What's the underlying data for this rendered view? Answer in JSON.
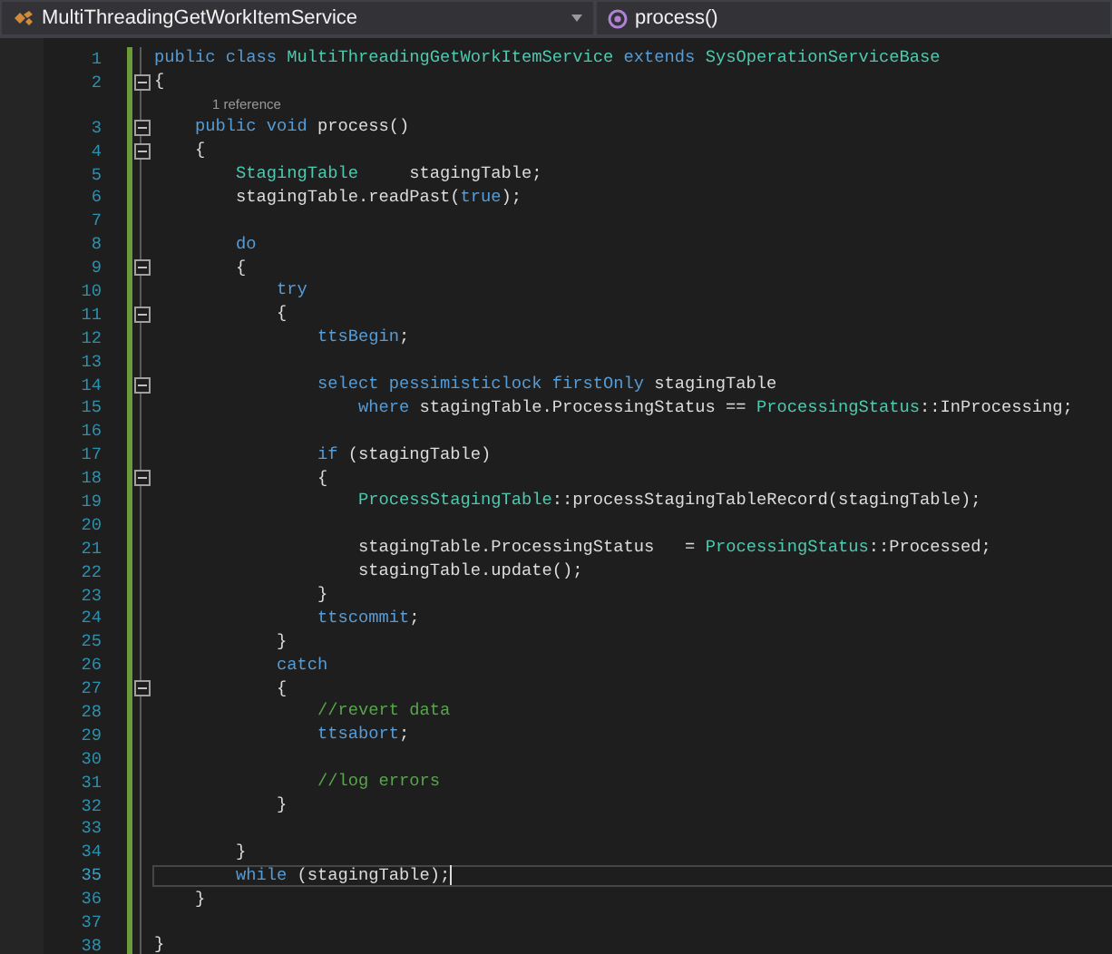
{
  "navigation_bar": {
    "type_dropdown": "MultiThreadingGetWorkItemService",
    "member_dropdown": "process()"
  },
  "lines": [
    {
      "number": "1",
      "fold": false,
      "current": false,
      "tokens": [
        {
          "kind": "keyword",
          "text": "public class "
        },
        {
          "kind": "type",
          "text": "MultiThreadingGetWorkItemService"
        },
        {
          "kind": "keyword",
          "text": " extends "
        },
        {
          "kind": "type",
          "text": "SysOperationServiceBase"
        }
      ]
    },
    {
      "number": "2",
      "fold": true,
      "current": false,
      "tokens": [
        {
          "kind": "plain",
          "text": "{"
        }
      ]
    },
    {
      "number": "3",
      "fold": true,
      "current": false,
      "codelens": "1 reference",
      "tokens": [
        {
          "kind": "keyword",
          "text": "    public void "
        },
        {
          "kind": "plain",
          "text": "process()"
        }
      ]
    },
    {
      "number": "4",
      "fold": true,
      "current": false,
      "tokens": [
        {
          "kind": "plain",
          "text": "    {"
        }
      ]
    },
    {
      "number": "5",
      "fold": false,
      "current": false,
      "tokens": [
        {
          "kind": "type",
          "text": "        StagingTable"
        },
        {
          "kind": "plain",
          "text": "     stagingTable;"
        }
      ]
    },
    {
      "number": "6",
      "fold": false,
      "current": false,
      "tokens": [
        {
          "kind": "plain",
          "text": "        stagingTable.readPast("
        },
        {
          "kind": "keyword",
          "text": "true"
        },
        {
          "kind": "plain",
          "text": ");"
        }
      ]
    },
    {
      "number": "7",
      "fold": false,
      "current": false
    },
    {
      "number": "8",
      "fold": false,
      "current": false,
      "tokens": [
        {
          "kind": "keyword",
          "text": "        do"
        }
      ]
    },
    {
      "number": "9",
      "fold": true,
      "current": false,
      "tokens": [
        {
          "kind": "plain",
          "text": "        {"
        }
      ]
    },
    {
      "number": "10",
      "fold": false,
      "current": false,
      "tokens": [
        {
          "kind": "keyword",
          "text": "            try"
        }
      ]
    },
    {
      "number": "11",
      "fold": true,
      "current": false,
      "tokens": [
        {
          "kind": "plain",
          "text": "            {"
        }
      ]
    },
    {
      "number": "12",
      "fold": false,
      "current": false,
      "tokens": [
        {
          "kind": "keyword",
          "text": "                ttsBegin"
        },
        {
          "kind": "plain",
          "text": ";"
        }
      ]
    },
    {
      "number": "13",
      "fold": false,
      "current": false
    },
    {
      "number": "14",
      "fold": true,
      "current": false,
      "tokens": [
        {
          "kind": "keyword",
          "text": "                select pessimisticlock firstOnly "
        },
        {
          "kind": "plain",
          "text": "stagingTable"
        }
      ]
    },
    {
      "number": "15",
      "fold": false,
      "current": false,
      "tokens": [
        {
          "kind": "keyword",
          "text": "                    where "
        },
        {
          "kind": "plain",
          "text": "stagingTable.ProcessingStatus == "
        },
        {
          "kind": "type",
          "text": "ProcessingStatus"
        },
        {
          "kind": "plain",
          "text": "::InProcessing;"
        }
      ]
    },
    {
      "number": "16",
      "fold": false,
      "current": false
    },
    {
      "number": "17",
      "fold": false,
      "current": false,
      "tokens": [
        {
          "kind": "keyword",
          "text": "                if "
        },
        {
          "kind": "plain",
          "text": "(stagingTable)"
        }
      ]
    },
    {
      "number": "18",
      "fold": true,
      "current": false,
      "tokens": [
        {
          "kind": "plain",
          "text": "                {"
        }
      ]
    },
    {
      "number": "19",
      "fold": false,
      "current": false,
      "tokens": [
        {
          "kind": "type",
          "text": "                    ProcessStagingTable"
        },
        {
          "kind": "plain",
          "text": "::processStagingTableRecord(stagingTable);"
        }
      ]
    },
    {
      "number": "20",
      "fold": false,
      "current": false
    },
    {
      "number": "21",
      "fold": false,
      "current": false,
      "tokens": [
        {
          "kind": "plain",
          "text": "                    stagingTable.ProcessingStatus   = "
        },
        {
          "kind": "type",
          "text": "ProcessingStatus"
        },
        {
          "kind": "plain",
          "text": "::Processed;"
        }
      ]
    },
    {
      "number": "22",
      "fold": false,
      "current": false,
      "tokens": [
        {
          "kind": "plain",
          "text": "                    stagingTable.update();"
        }
      ]
    },
    {
      "number": "23",
      "fold": false,
      "current": false,
      "tokens": [
        {
          "kind": "plain",
          "text": "                }"
        }
      ]
    },
    {
      "number": "24",
      "fold": false,
      "current": false,
      "tokens": [
        {
          "kind": "keyword",
          "text": "                ttscommit"
        },
        {
          "kind": "plain",
          "text": ";"
        }
      ]
    },
    {
      "number": "25",
      "fold": false,
      "current": false,
      "tokens": [
        {
          "kind": "plain",
          "text": "            }"
        }
      ]
    },
    {
      "number": "26",
      "fold": false,
      "current": false,
      "tokens": [
        {
          "kind": "keyword",
          "text": "            catch"
        }
      ]
    },
    {
      "number": "27",
      "fold": true,
      "current": false,
      "tokens": [
        {
          "kind": "plain",
          "text": "            {"
        }
      ]
    },
    {
      "number": "28",
      "fold": false,
      "current": false,
      "tokens": [
        {
          "kind": "comment",
          "text": "                //revert data"
        }
      ]
    },
    {
      "number": "29",
      "fold": false,
      "current": false,
      "tokens": [
        {
          "kind": "keyword",
          "text": "                ttsabort"
        },
        {
          "kind": "plain",
          "text": ";"
        }
      ]
    },
    {
      "number": "30",
      "fold": false,
      "current": false
    },
    {
      "number": "31",
      "fold": false,
      "current": false,
      "tokens": [
        {
          "kind": "comment",
          "text": "                //log errors"
        }
      ]
    },
    {
      "number": "32",
      "fold": false,
      "current": false,
      "tokens": [
        {
          "kind": "plain",
          "text": "            }"
        }
      ]
    },
    {
      "number": "33",
      "fold": false,
      "current": false
    },
    {
      "number": "34",
      "fold": false,
      "current": false,
      "tokens": [
        {
          "kind": "plain",
          "text": "        }"
        }
      ]
    },
    {
      "number": "35",
      "fold": false,
      "current": true,
      "tokens": [
        {
          "kind": "keyword",
          "text": "        while "
        },
        {
          "kind": "plain",
          "text": "(stagingTable);"
        }
      ]
    },
    {
      "number": "36",
      "fold": false,
      "current": false,
      "tokens": [
        {
          "kind": "plain",
          "text": "    }"
        }
      ]
    },
    {
      "number": "37",
      "fold": false,
      "current": false
    },
    {
      "number": "38",
      "fold": false,
      "current": false,
      "tokens": [
        {
          "kind": "plain",
          "text": "}"
        }
      ]
    }
  ]
}
